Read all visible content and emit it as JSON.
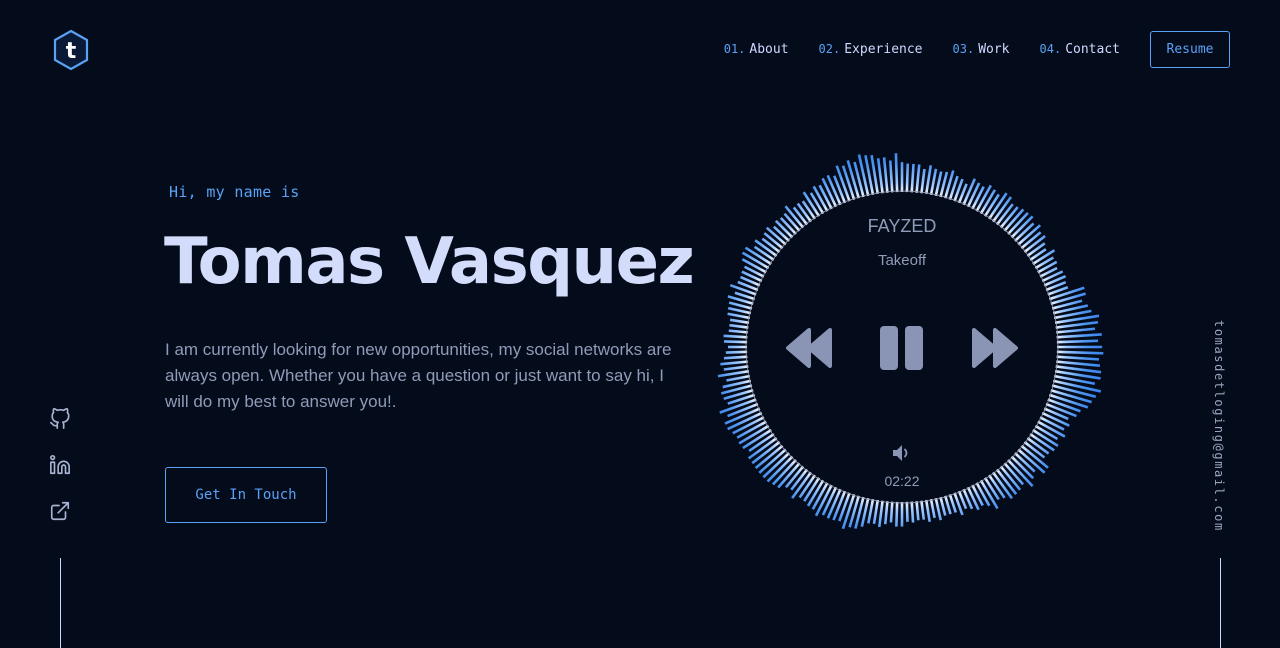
{
  "header": {
    "logo_letter": "t",
    "nav": [
      {
        "num": "01.",
        "label": "About"
      },
      {
        "num": "02.",
        "label": "Experience"
      },
      {
        "num": "03.",
        "label": "Work"
      },
      {
        "num": "04.",
        "label": "Contact"
      }
    ],
    "resume_label": "Resume"
  },
  "hero": {
    "greeting": "Hi, my name is",
    "name": "Tomas Vasquez",
    "description": "I am currently looking for new opportunities, my social networks are always open. Whether you have a question or just want to say hi, I will do my best to answer you!.",
    "cta_label": "Get In Touch"
  },
  "social": {
    "icons": [
      "github-icon",
      "linkedin-icon",
      "external-link-icon"
    ]
  },
  "email": "tomasdetloging@gmail.com",
  "player": {
    "artist": "FAYZED",
    "track": "Takeoff",
    "time": "02:22",
    "controls": [
      "rewind-icon",
      "pause-icon",
      "fast-forward-icon",
      "volume-icon"
    ]
  },
  "colors": {
    "background": "#040b1a",
    "accent": "#5aa2f5",
    "heading": "#d4dcfb",
    "body_text": "#8f9bb8",
    "control": "#8a95b5"
  }
}
